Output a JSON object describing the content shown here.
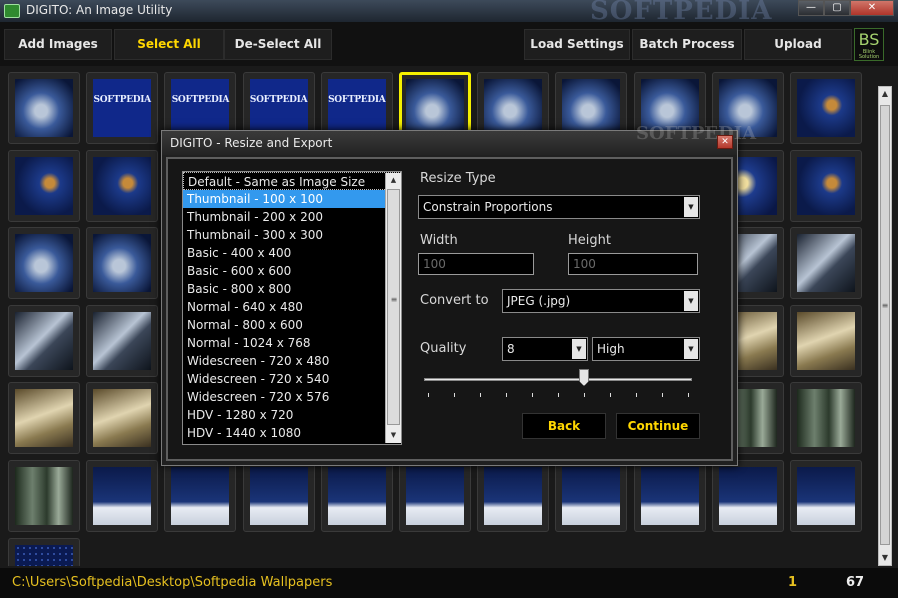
{
  "window": {
    "title": "DIGITO: An Image Utility",
    "watermark": "SOFTPEDIA",
    "minimize_glyph": "—",
    "maximize_glyph": "▢",
    "close_glyph": "✕"
  },
  "toolbar": {
    "add_images": "Add Images",
    "select_all": "Select All",
    "deselect_all": "De-Select All",
    "load_settings": "Load Settings",
    "batch_process": "Batch Process",
    "upload": "Upload",
    "logo": "BS",
    "logo_sub": "Blink Solution"
  },
  "thumbnails": {
    "row1": [
      "feather",
      "softp",
      "softp",
      "softp",
      "softp",
      "feather",
      "feather",
      "feather",
      "feather",
      "feather",
      "swirl"
    ],
    "softpedia_text": "SOFTPEDIA"
  },
  "dialog": {
    "title": "DIGITO - Resize and Export",
    "watermark": "SOFTPEDIA",
    "close_glyph": "✕",
    "presets": [
      "Default - Same as Image Size",
      "Thumbnail - 100 x 100",
      "Thumbnail - 200 x 200",
      "Thumbnail - 300 x 300",
      "Basic - 400 x 400",
      "Basic - 600 x 600",
      "Basic - 800 x 800",
      "Normal - 640 x 480",
      "Normal - 800 x 600",
      "Normal - 1024 x 768",
      "Widescreen - 720 x 480",
      "Widescreen - 720 x 540",
      "Widescreen - 720 x 576",
      "HDV - 1280 x 720",
      "HDV - 1440 x 1080"
    ],
    "selected_preset": "Thumbnail - 100 x 100",
    "resize_type_label": "Resize Type",
    "resize_type_value": "Constrain Proportions",
    "width_label": "Width",
    "width_value": "100",
    "height_label": "Height",
    "height_value": "100",
    "convert_label": "Convert to",
    "convert_value": "JPEG (.jpg)",
    "quality_label": "Quality",
    "quality_number": "8",
    "quality_level": "High",
    "quality_slider_fraction": 0.6,
    "back_label": "Back",
    "continue_label": "Continue"
  },
  "status": {
    "path": "C:\\Users\\Softpedia\\Desktop\\Softpedia Wallpapers",
    "selected_count": "1",
    "total_count": "67"
  },
  "colors": {
    "accent_yellow": "#ffd700",
    "selection_blue": "#3399ee",
    "selected_thumb_border": "#f5f000"
  }
}
